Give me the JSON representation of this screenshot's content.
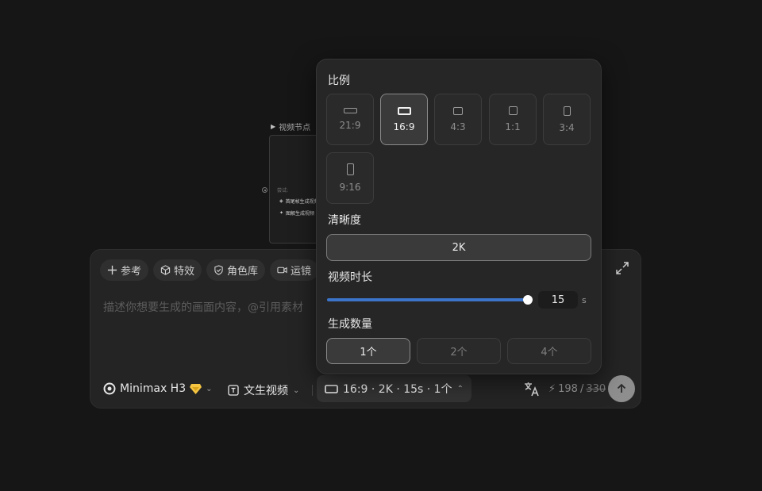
{
  "node": {
    "title": "视频节点",
    "try_label": "尝试:",
    "options": [
      "首尾帧生成视频",
      "图解生成视频"
    ]
  },
  "composer": {
    "chips": [
      {
        "label": "参考",
        "icon": "plus-icon"
      },
      {
        "label": "特效",
        "icon": "cube-icon"
      },
      {
        "label": "角色库",
        "icon": "shield-icon"
      },
      {
        "label": "运镜",
        "icon": "camera-icon"
      }
    ],
    "placeholder": "描述你想要生成的画面内容，@引用素材",
    "model": "Minimax H3",
    "mode": "文生视频",
    "params_summary": "16:9 · 2K · 15s · 1个",
    "credits": {
      "current": "198",
      "original": "330"
    }
  },
  "popover": {
    "ratio_title": "比例",
    "ratios": [
      {
        "label": "21:9",
        "selected": false
      },
      {
        "label": "16:9",
        "selected": true
      },
      {
        "label": "4:3",
        "selected": false
      },
      {
        "label": "1:1",
        "selected": false
      },
      {
        "label": "3:4",
        "selected": false
      },
      {
        "label": "9:16",
        "selected": false
      }
    ],
    "resolution_title": "清晰度",
    "resolution": "2K",
    "duration_title": "视频时长",
    "duration_value": "15",
    "duration_unit": "s",
    "duration_fraction": 1.0,
    "count_title": "生成数量",
    "counts": [
      {
        "label": "1个",
        "selected": true
      },
      {
        "label": "2个",
        "selected": false
      },
      {
        "label": "4个",
        "selected": false
      }
    ]
  },
  "colors": {
    "accent_slider": "#3b74c9",
    "badge": "#f5c542"
  }
}
